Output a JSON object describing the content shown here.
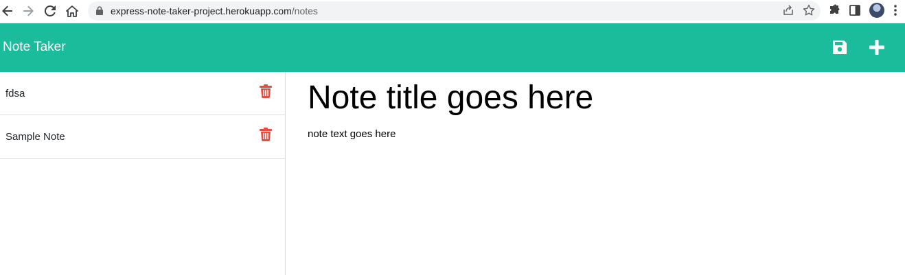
{
  "browser": {
    "url_host": "express-note-taker-project.herokuapp.com",
    "url_path": "/notes"
  },
  "header": {
    "brand": "Note Taker",
    "icons": [
      "save-icon",
      "plus-icon"
    ]
  },
  "sidebar": {
    "items": [
      {
        "label": "fdsa"
      },
      {
        "label": "Sample Note"
      }
    ]
  },
  "main": {
    "title_placeholder": "Note title goes here",
    "text_placeholder": "note text goes here"
  },
  "colors": {
    "header_bg": "#1abc9c",
    "trash": "#e74c3c",
    "white": "#ffffff"
  }
}
